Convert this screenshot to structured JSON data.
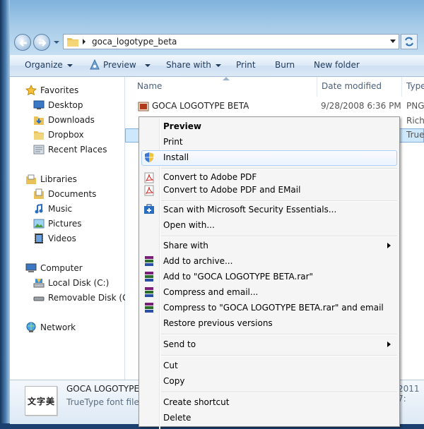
{
  "address": {
    "path": "goca_logotype_beta"
  },
  "toolbar": {
    "organize": "Organize",
    "preview": "Preview",
    "share_with": "Share with",
    "print": "Print",
    "burn": "Burn",
    "new_folder": "New folder"
  },
  "navpane": {
    "favorites": "Favorites",
    "desktop": "Desktop",
    "downloads": "Downloads",
    "dropbox": "Dropbox",
    "recent_places": "Recent Places",
    "libraries": "Libraries",
    "documents": "Documents",
    "music": "Music",
    "pictures": "Pictures",
    "videos": "Videos",
    "computer": "Computer",
    "local_disk": "Local Disk (C:)",
    "removable_disk": "Removable Disk (G:)",
    "network": "Network"
  },
  "columns": {
    "name": "Name",
    "date_modified": "Date modified",
    "type": "Type"
  },
  "files": [
    {
      "name": "GOCA LOGOTYPE BETA",
      "date": "9/28/2008 6:36 PM",
      "type": "PNG"
    },
    {
      "name": "",
      "date": "",
      "type": "Rich"
    },
    {
      "name": "",
      "date": "",
      "type": "True"
    }
  ],
  "details": {
    "thumb_text": "文字美",
    "name": "GOCA LOGOTYPE",
    "type": "TrueType font file",
    "date_fragment": "2011 7:"
  },
  "context_menu": {
    "preview": "Preview",
    "print": "Print",
    "install": "Install",
    "convert_pdf": "Convert to Adobe PDF",
    "convert_pdf_email": "Convert to Adobe PDF and EMail",
    "scan": "Scan with Microsoft Security Essentials...",
    "open_with": "Open with...",
    "share_with": "Share with",
    "add_archive": "Add to archive...",
    "add_rar": "Add to \"GOCA LOGOTYPE BETA.rar\"",
    "compress_email": "Compress and email...",
    "compress_rar_email": "Compress to \"GOCA LOGOTYPE BETA.rar\" and email",
    "restore": "Restore previous versions",
    "send_to": "Send to",
    "cut": "Cut",
    "copy": "Copy",
    "create_shortcut": "Create shortcut",
    "delete": "Delete"
  },
  "colors": {
    "highlight_border": "#aecff7",
    "selection": "#cde8fb",
    "toolbar_text": "#1e395b"
  }
}
